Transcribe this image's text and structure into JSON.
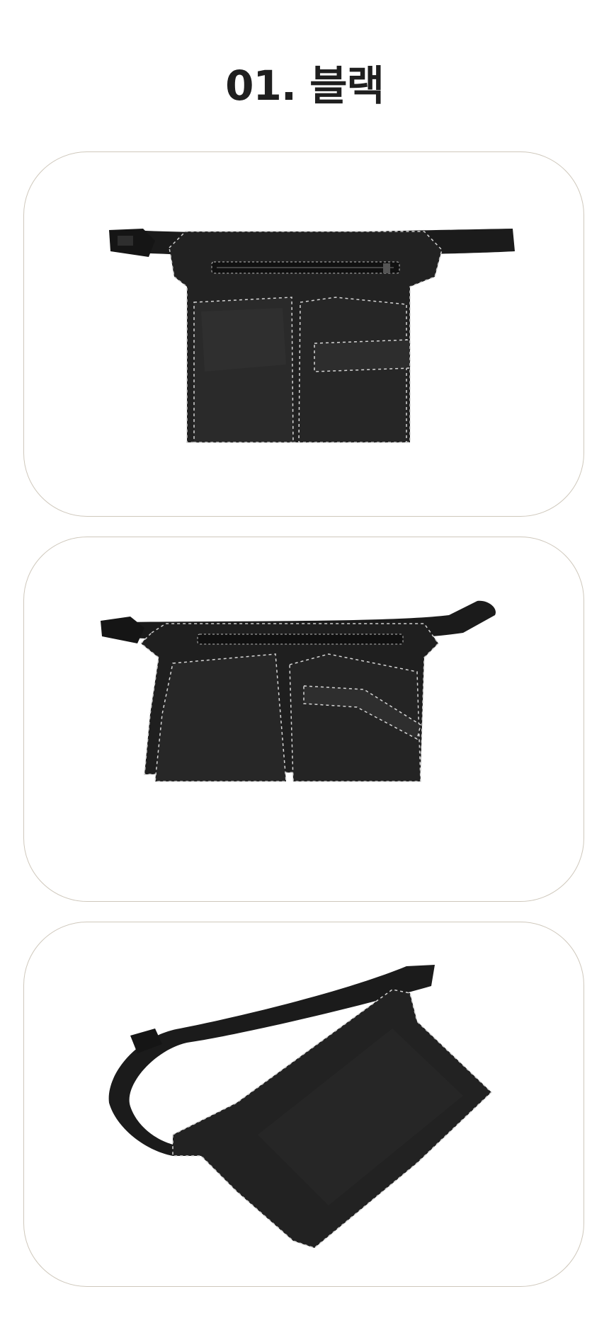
{
  "page": {
    "title": "01. 블랙",
    "colors": {
      "background": "#ffffff",
      "title_text": "#1f1f1f",
      "card_border": "#cfc8bc",
      "leather": "#232323",
      "stitching": "#d8d8d8"
    }
  },
  "photos": [
    {
      "view": "front",
      "icon": "waist-bag-front-photo"
    },
    {
      "view": "angled",
      "icon": "waist-bag-angled-photo"
    },
    {
      "view": "back",
      "icon": "waist-bag-back-photo"
    }
  ]
}
